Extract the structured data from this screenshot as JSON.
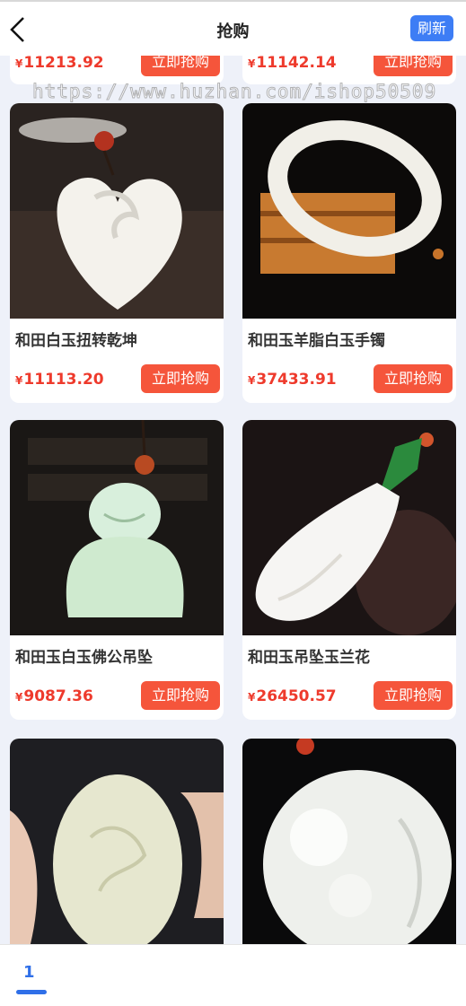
{
  "header": {
    "title": "抢购",
    "refresh_label": "刷新"
  },
  "watermark": "https://www.huzhan.com/ishop50509",
  "currency": "¥",
  "buy_label": "立即抢购",
  "top_row": [
    {
      "price": "11213.92"
    },
    {
      "price": "11142.14"
    }
  ],
  "products": [
    {
      "name": "和田白玉扭转乾坤",
      "price": "11113.20",
      "icon": "white-jade-heart-pendant"
    },
    {
      "name": "和田玉羊脂白玉手镯",
      "price": "37433.91",
      "icon": "white-jade-bangle"
    },
    {
      "name": "和田玉白玉佛公吊坠",
      "price": "9087.36",
      "icon": "jade-buddha-pendant"
    },
    {
      "name": "和田玉吊坠玉兰花",
      "price": "26450.57",
      "icon": "jade-magnolia-pendant"
    },
    {
      "name": "",
      "price": "",
      "icon": "carved-jade-pebble"
    },
    {
      "name": "",
      "price": "",
      "icon": "carved-jade-gourd-pendant"
    }
  ],
  "pagination": {
    "current": "1"
  },
  "colors": {
    "accent": "#3d7df5",
    "price": "#ee3a2c",
    "buy_button": "#f5553b"
  }
}
